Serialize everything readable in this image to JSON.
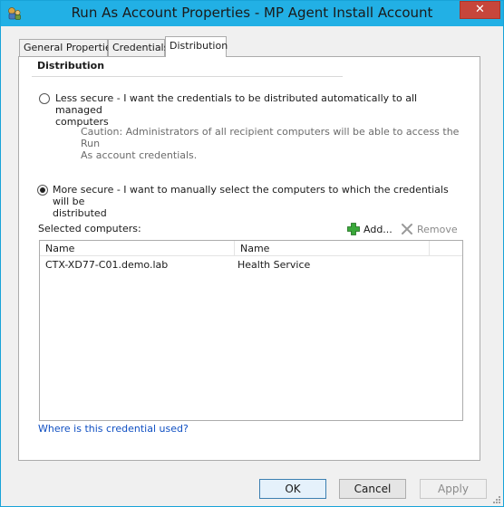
{
  "window": {
    "title": "Run As Account Properties - MP Agent Install Account",
    "close_glyph": "✕"
  },
  "tabs": [
    {
      "label": "General Properties"
    },
    {
      "label": "Credentials"
    },
    {
      "label": "Distribution"
    }
  ],
  "distribution": {
    "section_title": "Distribution",
    "less_secure": {
      "line1": "Less secure - I want the credentials to be distributed automatically to all managed",
      "line2": "computers",
      "selected": false
    },
    "caution": {
      "line1": "Caution: Administrators of all recipient computers will be able to access the Run",
      "line2": "As account credentials."
    },
    "more_secure": {
      "line1": "More secure - I want to manually select the computers to which the credentials will be",
      "line2": "distributed",
      "selected": true
    },
    "selected_computers_label": "Selected computers:",
    "add_label": "Add...",
    "remove_label": "Remove",
    "columns": [
      "Name",
      "Name"
    ],
    "rows": [
      {
        "computer": "CTX-XD77-C01.demo.lab",
        "service": "Health Service"
      }
    ],
    "help_link": "Where is this credential used?"
  },
  "buttons": {
    "ok": "OK",
    "cancel": "Cancel",
    "apply": "Apply"
  },
  "colors": {
    "titlebar": "#22b0e5",
    "close": "#c7463b",
    "link": "#0f4fc2",
    "add_green": "#3aa83a"
  }
}
